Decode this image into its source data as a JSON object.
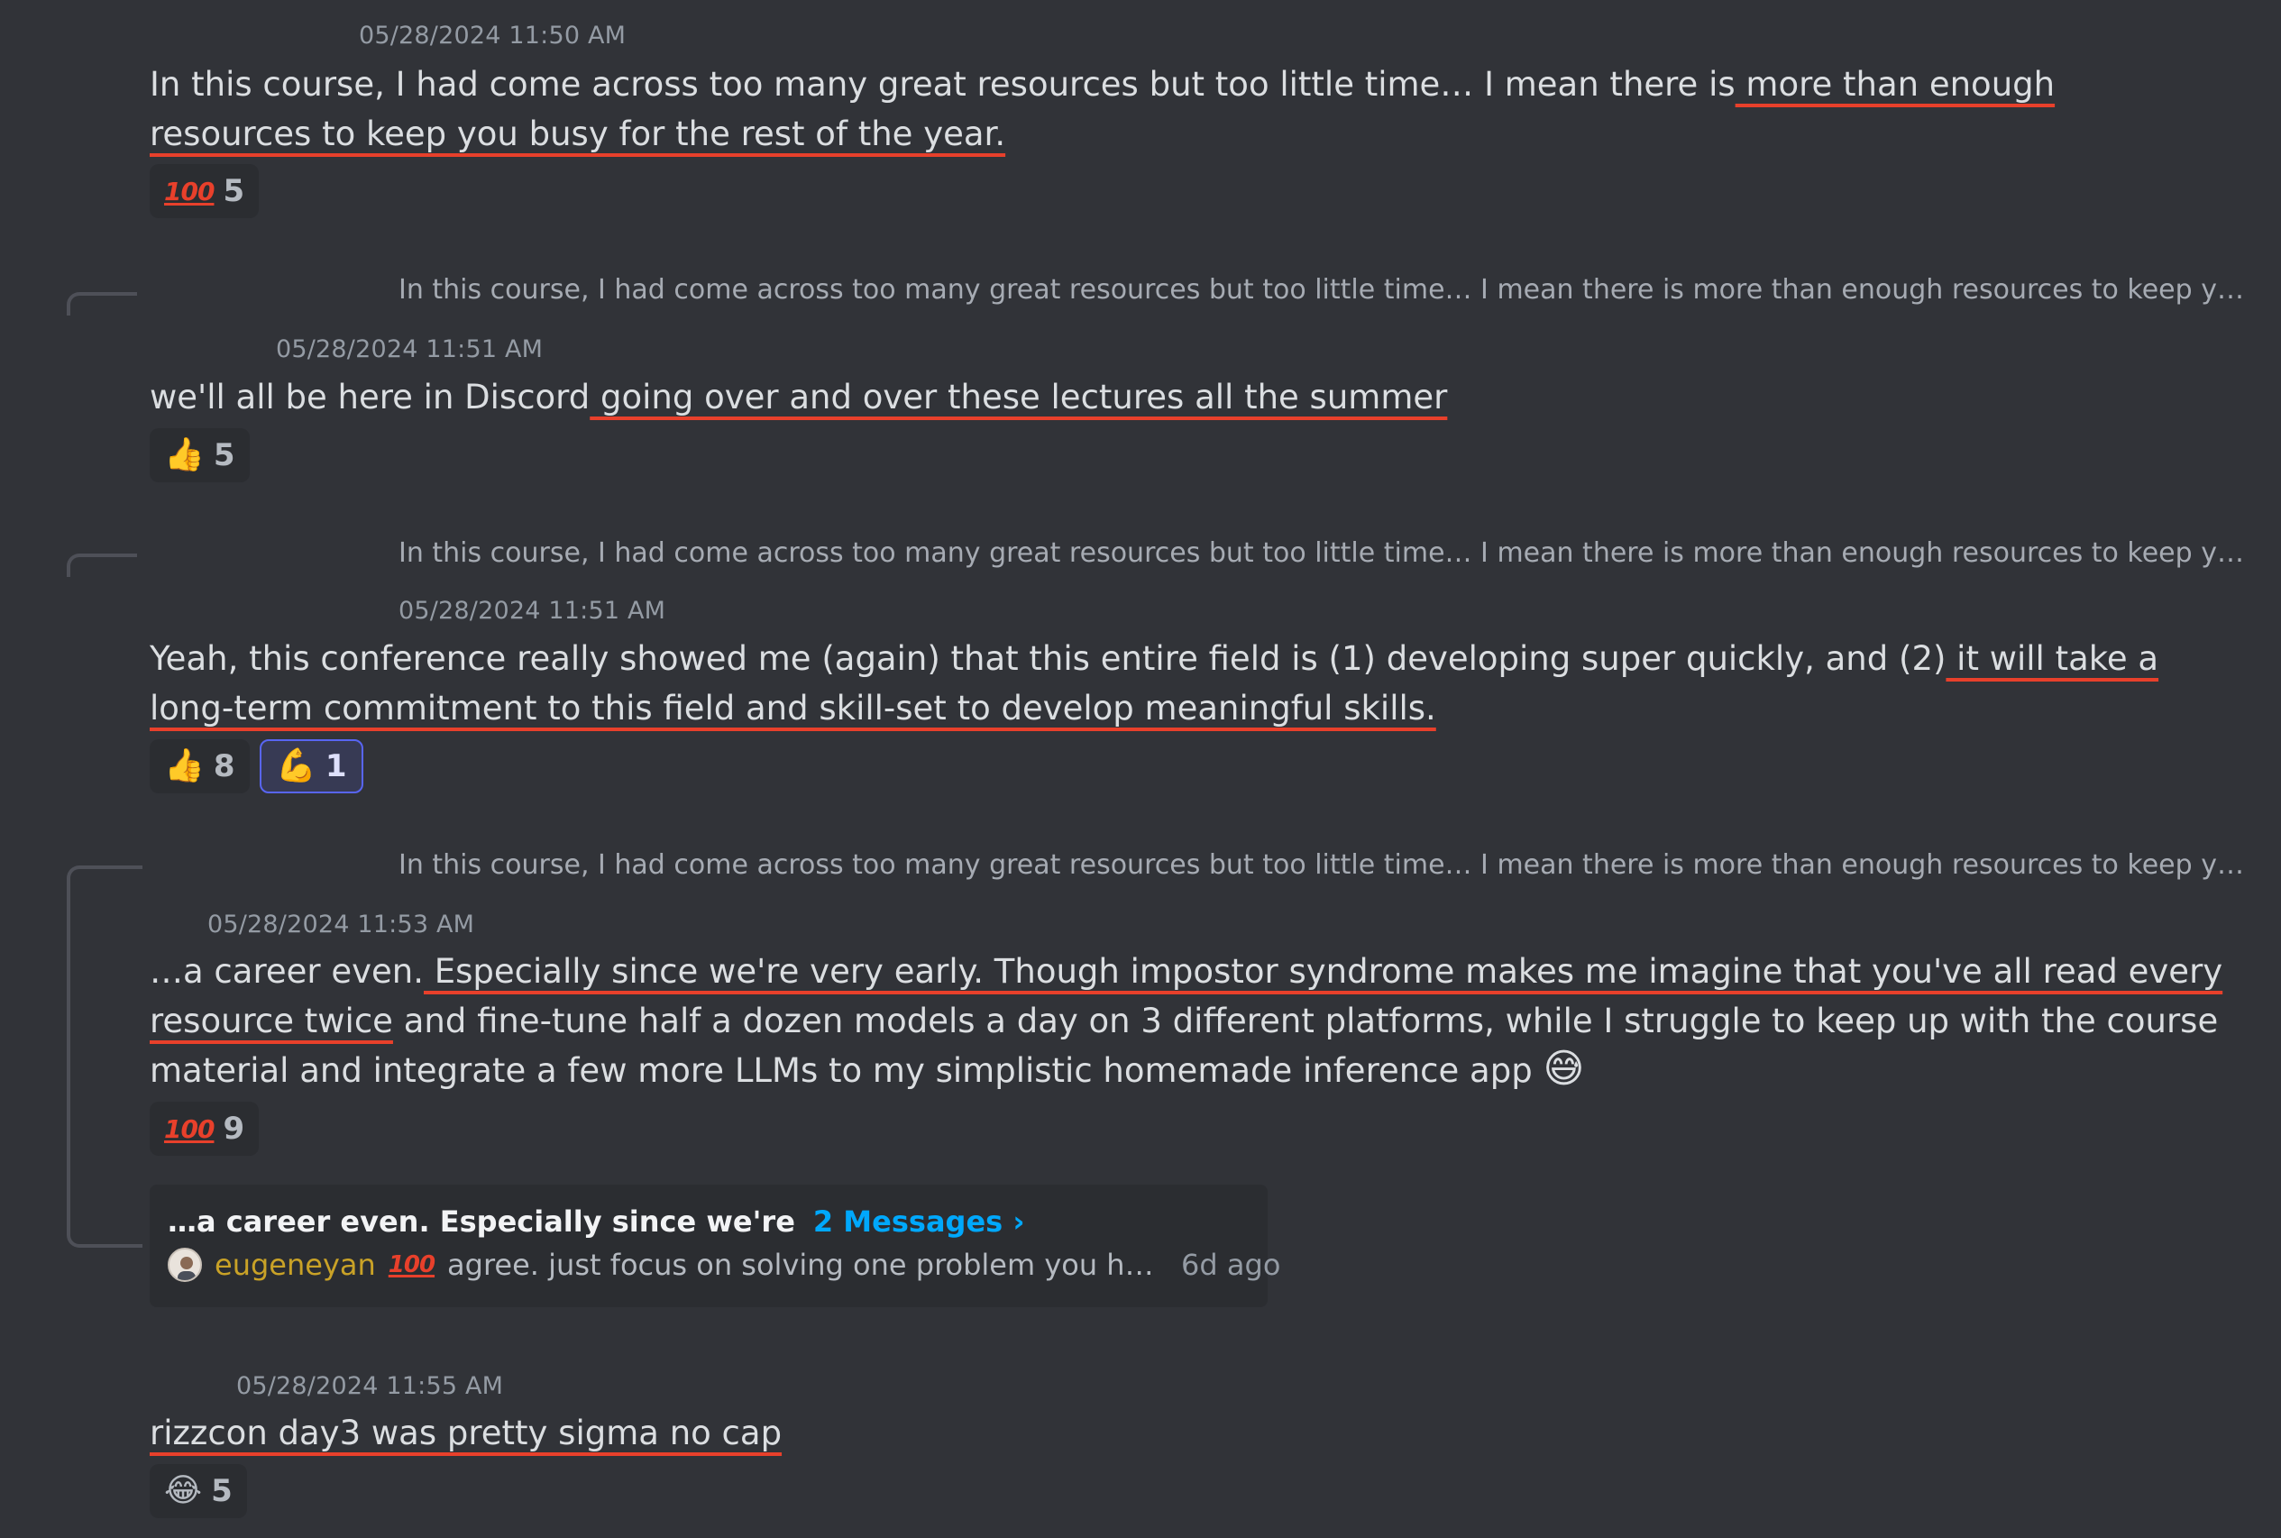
{
  "messages": [
    {
      "timestamp": "05/28/2024 11:50 AM",
      "text_plain": "In this course, I had come across too many great resources but too little time… I mean there is",
      "text_underlined": " more than enough resources to keep you busy for the rest of the year.",
      "reactions": [
        {
          "emoji": "100-emoji",
          "count": "5"
        }
      ]
    },
    {
      "reply_preview": "In this course, I had come across too many great resources but too little time… I mean there is more than enough resources to keep you b…",
      "timestamp": "05/28/2024 11:51 AM",
      "text_plain": "we'll all be here in Discord",
      "text_underlined": " going over and over these lectures all the summer ",
      "reactions": [
        {
          "emoji": "👍",
          "count": "5"
        }
      ]
    },
    {
      "reply_preview": "In this course, I had come across too many great resources but too little time… I mean there is more than enough resources to keep you b…",
      "timestamp": "05/28/2024 11:51 AM",
      "text_plain": "Yeah, this conference really showed me (again) that this entire field is (1) developing super quickly, and (2)",
      "text_underlined": " it will take a long-term commitment to this field and skill-set to develop meaningful skills.",
      "reactions": [
        {
          "emoji": "👍",
          "count": "8"
        },
        {
          "emoji": "💪",
          "count": "1"
        }
      ]
    },
    {
      "reply_preview": "In this course, I had come across too many great resources but too little time… I mean there is more than enough resources to keep you b…",
      "timestamp": "05/28/2024 11:53 AM",
      "text_plain": "…a career even.",
      "text_underlined": " Especially since we're very early. Though impostor syndrome makes me imagine that you've all read every resource twice",
      "text_after": " and fine-tune half a dozen models a day on 3 different platforms, while I struggle to keep up with the course material and integrate a few more LLMs to my simplistic homemade inference app",
      "inline_emoji": "😅",
      "reactions": [
        {
          "emoji": "100-emoji",
          "count": "9"
        }
      ],
      "thread": {
        "title": "…a career even. Especially since we're",
        "link": "2 Messages ›",
        "username": "eugeneyan",
        "username_emoji": "100-emoji",
        "last_message": "agree. just focus on solving one problem you have, o…",
        "time": "6d ago"
      }
    },
    {
      "timestamp": "05/28/2024 11:55 AM",
      "text_underlined": "rizzcon day3 was pretty sigma no cap",
      "reactions": [
        {
          "emoji": "😂",
          "count": "5"
        }
      ]
    }
  ],
  "hundred_glyph": "100",
  "colors": {
    "background": "#313338",
    "underline": "#e8402b",
    "username": "#c9a227",
    "link": "#00a8fc",
    "selected_reaction_border": "#5865f2"
  }
}
